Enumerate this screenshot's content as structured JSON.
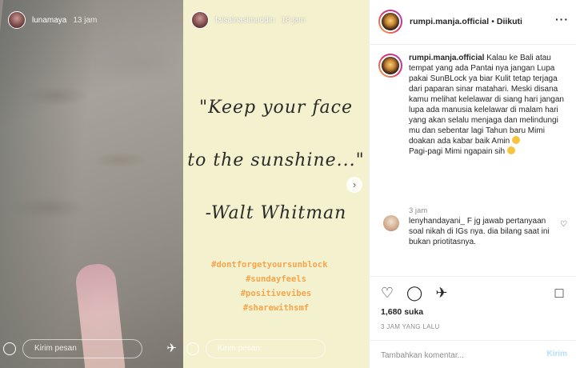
{
  "stories": [
    {
      "username": "lunamaya",
      "time": "13 jam",
      "reply_placeholder": "Kirim pesan"
    },
    {
      "username": "faisalnasimuddin",
      "time": "18 jam",
      "reply_placeholder": "Kirim pesan",
      "quote_lines": [
        "\"Keep your face",
        "to the sunshine...\"",
        "-Walt Whitman"
      ],
      "hashtags": [
        "#dontforgetyoursunblock",
        "#sundayfeels",
        "#positivevibes",
        "#sharewithsmf"
      ]
    }
  ],
  "post": {
    "username": "rumpi.manja.official",
    "follow_status": "Diikuti",
    "caption": "Kalau ke Bali atau tempat yang ada Pantai nya jangan Lupa pakai SunBLock ya biar Kulit tetap terjaga dari paparan sinar matahari. Meski disana kamu melihat kelelawar di siang hari jangan lupa ada manusia kelelawar di malam hari yang akan selalu menjaga dan melindungi mu dan sebentar lagi Tahun baru Mimi doakan ada kabar baik Amin",
    "caption_line2": "Pagi-pagi Mimi ngapain sih",
    "caption_time": "3 jam",
    "comment": {
      "username": "lenyhandayani_",
      "text": "F jg jawab pertanyaan soal nikah di IGs nya. dia bilang saat ini bukan priotitasnya."
    },
    "likes": "1,680 suka",
    "date": "3 JAM YANG LALU",
    "add_comment_placeholder": "Tambahkan komentar...",
    "post_button": "Kirim"
  },
  "colors": {
    "hashtag": "#f5a54e",
    "quote_bg": "#f4f1ce",
    "post_button": "#b2dffc",
    "secondary_text": "#8e8e8e"
  },
  "icons": {
    "like": "heart-icon",
    "comment": "comment-icon",
    "share": "send-icon",
    "save": "bookmark-icon",
    "camera": "camera-icon",
    "next": "chevron-right-icon"
  }
}
